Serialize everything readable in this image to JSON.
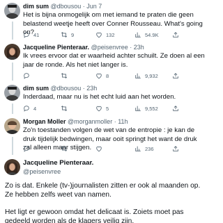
{
  "tweets": [
    {
      "name": "dim sum",
      "handle": "@dbousou",
      "dot": "·",
      "time": "Jun 7",
      "text": "Het is bijna onmogelijk om met iemand te praten die geen belastend weetje heeft over Conner Rousseau. What's going on?",
      "replies": "41",
      "retweets": "9",
      "likes": "132",
      "views": "54.9K"
    },
    {
      "name": "Jacqueline Pienteraar.",
      "handle": "@peisenvree",
      "dot": "·",
      "time": "23h",
      "text": "Ik vrees ervoor dat er waarheid achter schuilt. Ze doen al een jaar de ronde. Als het niet langer is.",
      "replies": "",
      "retweets": "",
      "likes": "8",
      "views": "9,932"
    },
    {
      "name": "dim sum",
      "handle": "@dbousou",
      "dot": "·",
      "time": "23h",
      "text": "Inderdaad, maar nu is het echt luid aan het worden.",
      "replies": "4",
      "retweets": "",
      "likes": "5",
      "views": "9,552"
    },
    {
      "name": "Morgan Moller",
      "handle": "@morganmoller",
      "dot": "·",
      "time": "11h",
      "text": "Zo'n toestanden volgen de wet van de entropie : je kan de druk tijdelijk bedwingen, maar ooit springt het want de druk zal alleen maar stijgen.",
      "replies": "",
      "retweets": "",
      "likes": "",
      "views": "236"
    }
  ],
  "main_tweet": {
    "name": "Jacqueline Pienteraar.",
    "handle": "@peisenvree",
    "paragraph1": "Zo is dat. Enkele (tv-)journalisten zitten er ook al maanden op. Ze hebben zelfs weet van namen.",
    "paragraph2": "Het ligt er gewoon omdat het delicaat is. Zoiets moet pas gedeeld worden als de klagers veilig zijn."
  },
  "colors": {
    "text": "#0f1419",
    "muted": "#536471",
    "thread_line": "#cfd9de"
  },
  "icons": [
    "reply-icon",
    "retweet-icon",
    "like-icon",
    "views-icon",
    "share-icon"
  ]
}
